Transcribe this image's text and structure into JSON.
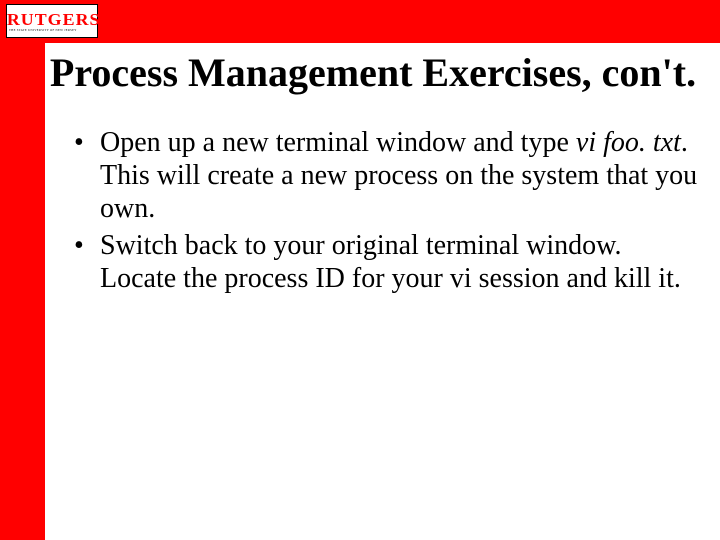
{
  "logo": {
    "name": "RUTGERS",
    "tagline": "THE STATE UNIVERSITY OF NEW JERSEY"
  },
  "title": "Process Management Exercises, con't.",
  "bullets": {
    "b1_pre": "Open up a new terminal window and type ",
    "b1_cmd": "vi foo. txt",
    "b1_post": ". This will create a new process on the system that you own.",
    "b2": "Switch back to your original terminal window.  Locate the process ID for your vi session and kill it."
  }
}
